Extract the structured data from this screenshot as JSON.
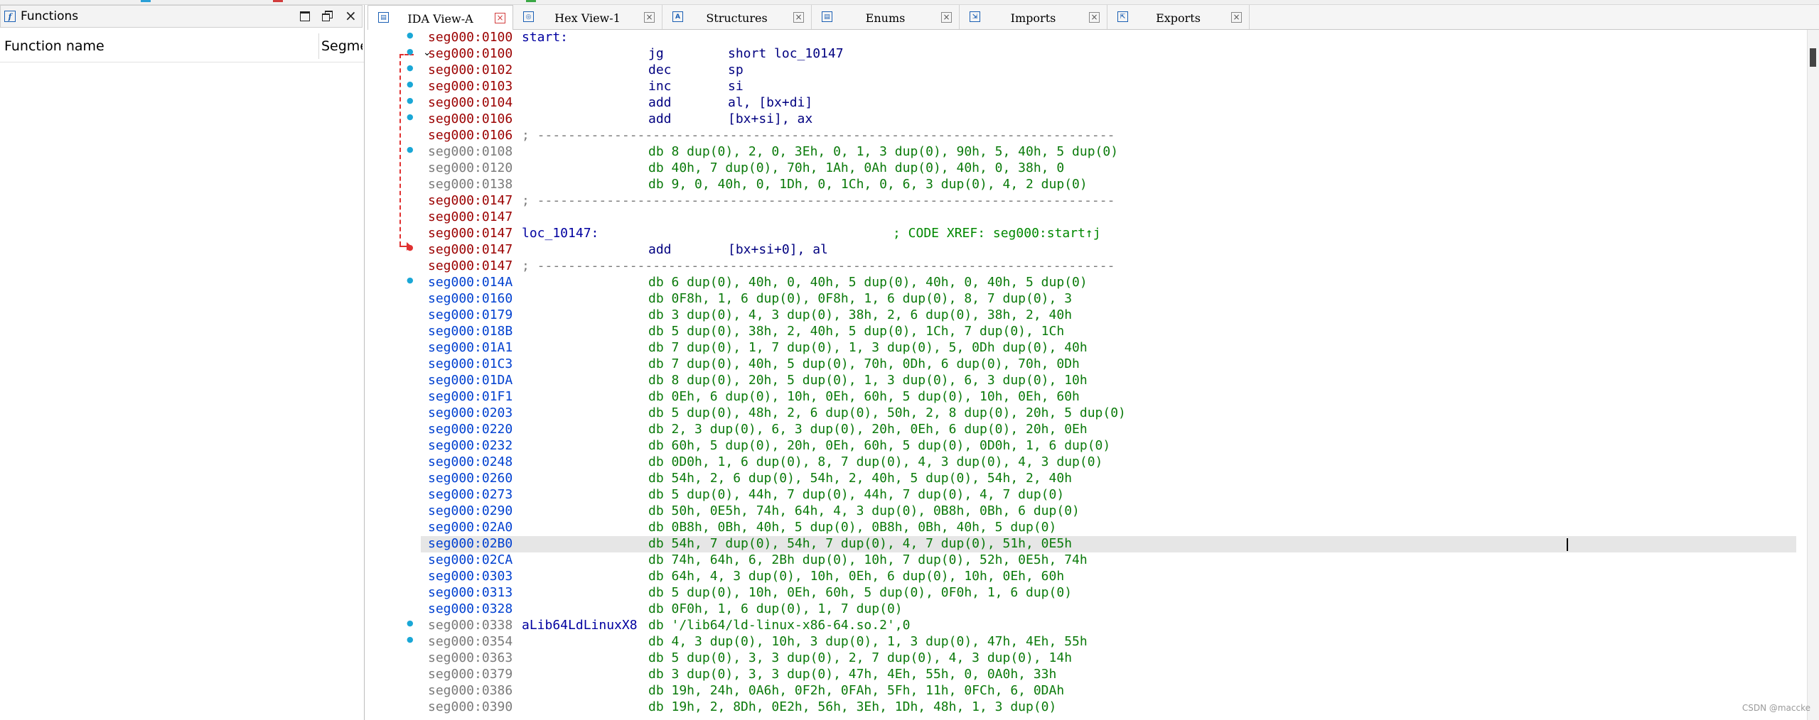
{
  "functions_panel": {
    "title": "Functions",
    "columns": [
      "Function name",
      "Segme"
    ],
    "icon": "function-icon"
  },
  "tabs": [
    {
      "label": "IDA View-A",
      "icon": "ida-view-icon",
      "active": true
    },
    {
      "label": "Hex View-1",
      "icon": "hex-view-icon",
      "active": false
    },
    {
      "label": "Structures",
      "icon": "structures-icon",
      "active": false
    },
    {
      "label": "Enums",
      "icon": "enums-icon",
      "active": false
    },
    {
      "label": "Imports",
      "icon": "imports-icon",
      "active": false
    },
    {
      "label": "Exports",
      "icon": "exports-icon",
      "active": false
    }
  ],
  "colors": {
    "address_red": "#9b0000",
    "address_blue": "#0040d0",
    "address_gray": "#7a7a7a",
    "data_green": "#0a7a0a",
    "xref_arrow": "#e03030",
    "highlight_row": "#e6e6e6"
  },
  "disasm": [
    {
      "addr": "seg000:0100",
      "c": "red",
      "label": "start:",
      "dot": "blue"
    },
    {
      "addr": "seg000:0100",
      "c": "red",
      "mnem": "jg",
      "ops": "short loc_10147",
      "dot": "blue"
    },
    {
      "addr": "seg000:0102",
      "c": "red",
      "mnem": "dec",
      "ops": "sp",
      "dot": "blue"
    },
    {
      "addr": "seg000:0103",
      "c": "red",
      "mnem": "inc",
      "ops": "si",
      "dot": "blue"
    },
    {
      "addr": "seg000:0104",
      "c": "red",
      "mnem": "add",
      "ops": "al, [bx+di]",
      "dot": "blue"
    },
    {
      "addr": "seg000:0106",
      "c": "red",
      "mnem": "add",
      "ops": "[bx+si], ax",
      "dot": "blue"
    },
    {
      "addr": "seg000:0106",
      "c": "red",
      "comment": "; ---------------------------------------------------------------------------"
    },
    {
      "addr": "seg000:0108",
      "c": "gray",
      "data": "db 8 dup(0), 2, 0, 3Eh, 0, 1, 3 dup(0), 90h, 5, 40h, 5 dup(0)",
      "dot": "blue"
    },
    {
      "addr": "seg000:0120",
      "c": "gray",
      "data": "db 40h, 7 dup(0), 70h, 1Ah, 0Ah dup(0), 40h, 0, 38h, 0"
    },
    {
      "addr": "seg000:0138",
      "c": "gray",
      "data": "db 9, 0, 40h, 0, 1Dh, 0, 1Ch, 0, 6, 3 dup(0), 4, 2 dup(0)"
    },
    {
      "addr": "seg000:0147",
      "c": "red",
      "comment": "; ---------------------------------------------------------------------------"
    },
    {
      "addr": "seg000:0147",
      "c": "red"
    },
    {
      "addr": "seg000:0147",
      "c": "red",
      "label": "loc_10147:",
      "xref": "; CODE XREF: seg000:start↑j"
    },
    {
      "addr": "seg000:0147",
      "c": "red",
      "mnem": "add",
      "ops": "[bx+si+0], al",
      "dot": "red"
    },
    {
      "addr": "seg000:0147",
      "c": "red",
      "comment": "; ---------------------------------------------------------------------------"
    },
    {
      "addr": "seg000:014A",
      "c": "blue",
      "data": "db 6 dup(0), 40h, 0, 40h, 5 dup(0), 40h, 0, 40h, 5 dup(0)",
      "dot": "blue"
    },
    {
      "addr": "seg000:0160",
      "c": "blue",
      "data": "db 0F8h, 1, 6 dup(0), 0F8h, 1, 6 dup(0), 8, 7 dup(0), 3"
    },
    {
      "addr": "seg000:0179",
      "c": "blue",
      "data": "db 3 dup(0), 4, 3 dup(0), 38h, 2, 6 dup(0), 38h, 2, 40h"
    },
    {
      "addr": "seg000:018B",
      "c": "blue",
      "data": "db 5 dup(0), 38h, 2, 40h, 5 dup(0), 1Ch, 7 dup(0), 1Ch"
    },
    {
      "addr": "seg000:01A1",
      "c": "blue",
      "data": "db 7 dup(0), 1, 7 dup(0), 1, 3 dup(0), 5, 0Dh dup(0), 40h"
    },
    {
      "addr": "seg000:01C3",
      "c": "blue",
      "data": "db 7 dup(0), 40h, 5 dup(0), 70h, 0Dh, 6 dup(0), 70h, 0Dh"
    },
    {
      "addr": "seg000:01DA",
      "c": "blue",
      "data": "db 8 dup(0), 20h, 5 dup(0), 1, 3 dup(0), 6, 3 dup(0), 10h"
    },
    {
      "addr": "seg000:01F1",
      "c": "blue",
      "data": "db 0Eh, 6 dup(0), 10h, 0Eh, 60h, 5 dup(0), 10h, 0Eh, 60h"
    },
    {
      "addr": "seg000:0203",
      "c": "blue",
      "data": "db 5 dup(0), 48h, 2, 6 dup(0), 50h, 2, 8 dup(0), 20h, 5 dup(0)"
    },
    {
      "addr": "seg000:0220",
      "c": "blue",
      "data": "db 2, 3 dup(0), 6, 3 dup(0), 20h, 0Eh, 6 dup(0), 20h, 0Eh"
    },
    {
      "addr": "seg000:0232",
      "c": "blue",
      "data": "db 60h, 5 dup(0), 20h, 0Eh, 60h, 5 dup(0), 0D0h, 1, 6 dup(0)"
    },
    {
      "addr": "seg000:0248",
      "c": "blue",
      "data": "db 0D0h, 1, 6 dup(0), 8, 7 dup(0), 4, 3 dup(0), 4, 3 dup(0)"
    },
    {
      "addr": "seg000:0260",
      "c": "blue",
      "data": "db 54h, 2, 6 dup(0), 54h, 2, 40h, 5 dup(0), 54h, 2, 40h"
    },
    {
      "addr": "seg000:0273",
      "c": "blue",
      "data": "db 5 dup(0), 44h, 7 dup(0), 44h, 7 dup(0), 4, 7 dup(0)"
    },
    {
      "addr": "seg000:0290",
      "c": "blue",
      "data": "db 50h, 0E5h, 74h, 64h, 4, 3 dup(0), 0B8h, 0Bh, 6 dup(0)"
    },
    {
      "addr": "seg000:02A0",
      "c": "blue",
      "data": "db 0B8h, 0Bh, 40h, 5 dup(0), 0B8h, 0Bh, 40h, 5 dup(0)"
    },
    {
      "addr": "seg000:02B0",
      "c": "blue",
      "data": "db 54h, 7 dup(0), 54h, 7 dup(0), 4, 7 dup(0), 51h, 0E5h",
      "highlight": true
    },
    {
      "addr": "seg000:02CA",
      "c": "blue",
      "data": "db 74h, 64h, 6, 2Bh dup(0), 10h, 7 dup(0), 52h, 0E5h, 74h"
    },
    {
      "addr": "seg000:0303",
      "c": "blue",
      "data": "db 64h, 4, 3 dup(0), 10h, 0Eh, 6 dup(0), 10h, 0Eh, 60h"
    },
    {
      "addr": "seg000:0313",
      "c": "blue",
      "data": "db 5 dup(0), 10h, 0Eh, 60h, 5 dup(0), 0F0h, 1, 6 dup(0)"
    },
    {
      "addr": "seg000:0328",
      "c": "blue",
      "data": "db 0F0h, 1, 6 dup(0), 1, 7 dup(0)"
    },
    {
      "addr": "seg000:0338",
      "c": "gray",
      "label": "aLib64LdLinuxX8",
      "data": "db '/lib64/ld-linux-x86-64.so.2',0",
      "dot": "blue"
    },
    {
      "addr": "seg000:0354",
      "c": "gray",
      "data": "db 4, 3 dup(0), 10h, 3 dup(0), 1, 3 dup(0), 47h, 4Eh, 55h",
      "dot": "blue"
    },
    {
      "addr": "seg000:0363",
      "c": "gray",
      "data": "db 5 dup(0), 3, 3 dup(0), 2, 7 dup(0), 4, 3 dup(0), 14h"
    },
    {
      "addr": "seg000:0379",
      "c": "gray",
      "data": "db 3 dup(0), 3, 3 dup(0), 47h, 4Eh, 55h, 0, 0A0h, 33h"
    },
    {
      "addr": "seg000:0386",
      "c": "gray",
      "data": "db 19h, 24h, 0A6h, 0F2h, 0FAh, 5Fh, 11h, 0FCh, 6, 0DAh"
    },
    {
      "addr": "seg000:0390",
      "c": "gray",
      "data": "db 19h, 2, 8Dh, 0E2h, 56h, 3Eh, 1Dh, 48h, 1, 3 dup(0)"
    }
  ],
  "watermark": "CSDN @maccke"
}
